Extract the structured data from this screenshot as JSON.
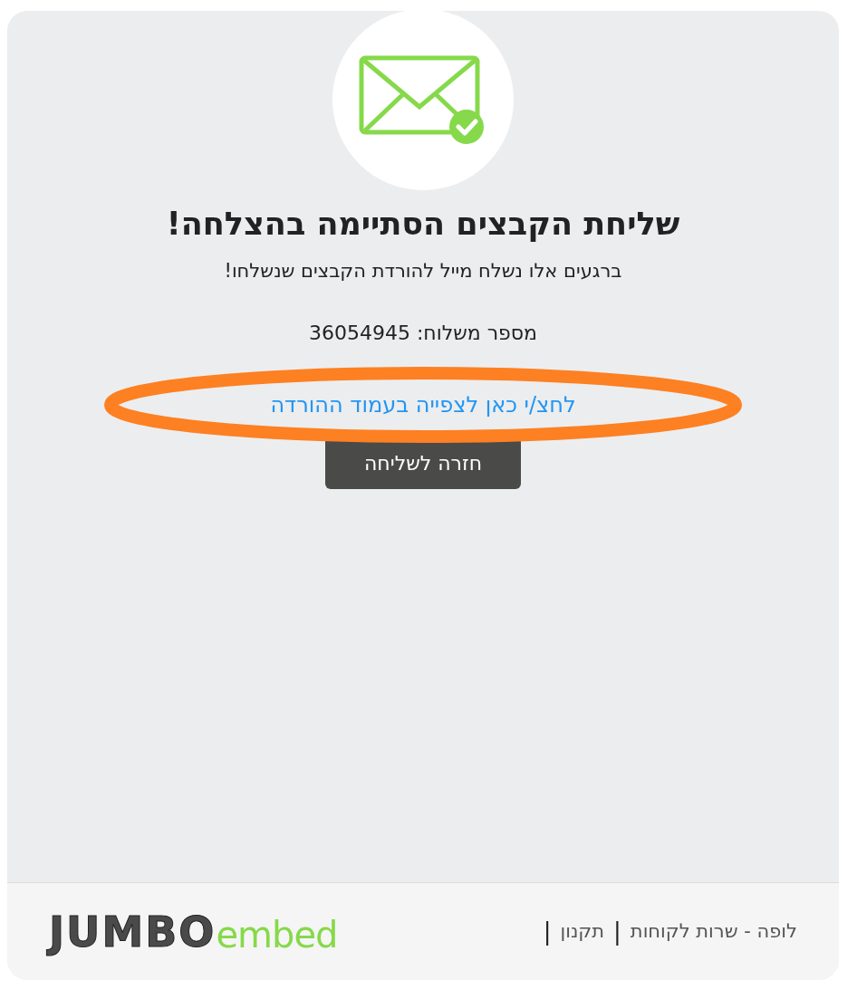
{
  "title": "שליחת הקבצים הסתיימה בהצלחה!",
  "message": "ברגעים אלו נשלח מייל להורדת הקבצים שנשלחו!",
  "shipment": "מספר משלוח: 36054945",
  "download_link": {
    "label": "לחצ/י כאן לצפייה בעמוד ההורדה",
    "highlighted": true
  },
  "back_button": "חזרה לשליחה",
  "footer": {
    "items": [
      {
        "kind": "link",
        "text": "לופה - שרות לקוחות"
      },
      {
        "kind": "separator",
        "text": "|"
      },
      {
        "kind": "link",
        "text": "תקנון"
      },
      {
        "kind": "separator",
        "text": "|"
      }
    ],
    "logo": {
      "word": "JUMBO",
      "suffix": "embed"
    }
  }
}
